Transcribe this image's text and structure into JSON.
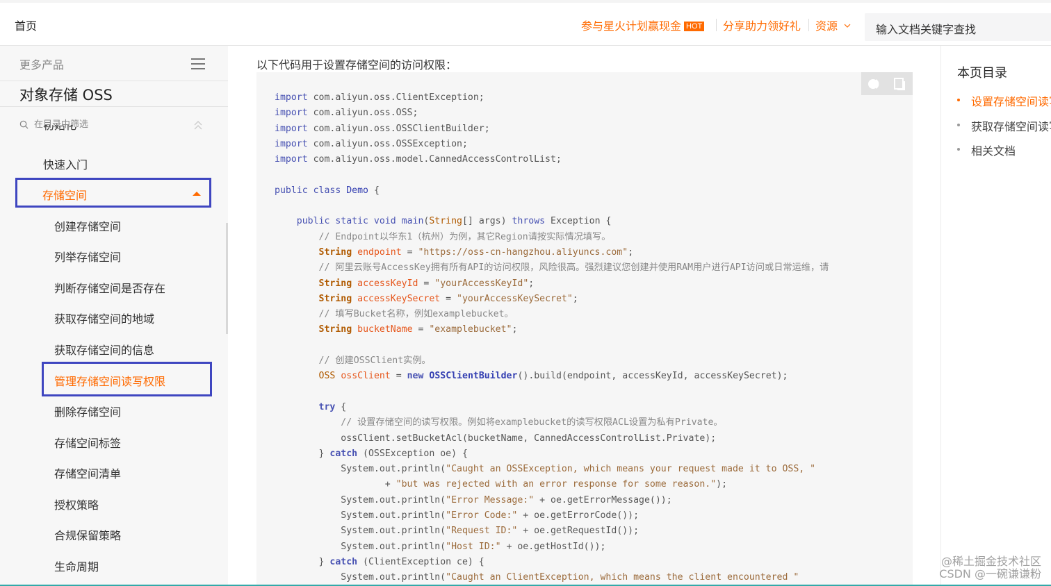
{
  "header": {
    "home": "首页",
    "promo": "参与星火计划赢现金",
    "hot_badge": "HOT",
    "share": "分享助力领好礼",
    "resources": "资源",
    "search_placeholder": "输入文档关键字查找"
  },
  "sidebar": {
    "more_products": "更多产品",
    "product_title": "对象存储 OSS",
    "filter_placeholder": "在目录中筛选",
    "cut_item": "初始化",
    "items": [
      "快速入门",
      "存储空间",
      "创建存储空间",
      "列举存储空间",
      "判断存储空间是否存在",
      "获取存储空间的地域",
      "获取存储空间的信息",
      "管理存储空间读写权限",
      "删除存储空间",
      "存储空间标签",
      "存储空间清单",
      "授权策略",
      "合规保留策略",
      "生命周期"
    ]
  },
  "main": {
    "intro": "以下代码用于设置存储空间的访问权限："
  },
  "toc": {
    "title": "本页目录",
    "items": [
      "设置存储空间读写",
      "获取存储空间读写",
      "相关文档"
    ]
  },
  "watermark": {
    "line1": "@稀土掘金技术社区",
    "line2": "CSDN @一碗谦谦粉"
  },
  "colors": {
    "accent": "#ff6a00",
    "highlight_border": "#3f46c0"
  }
}
